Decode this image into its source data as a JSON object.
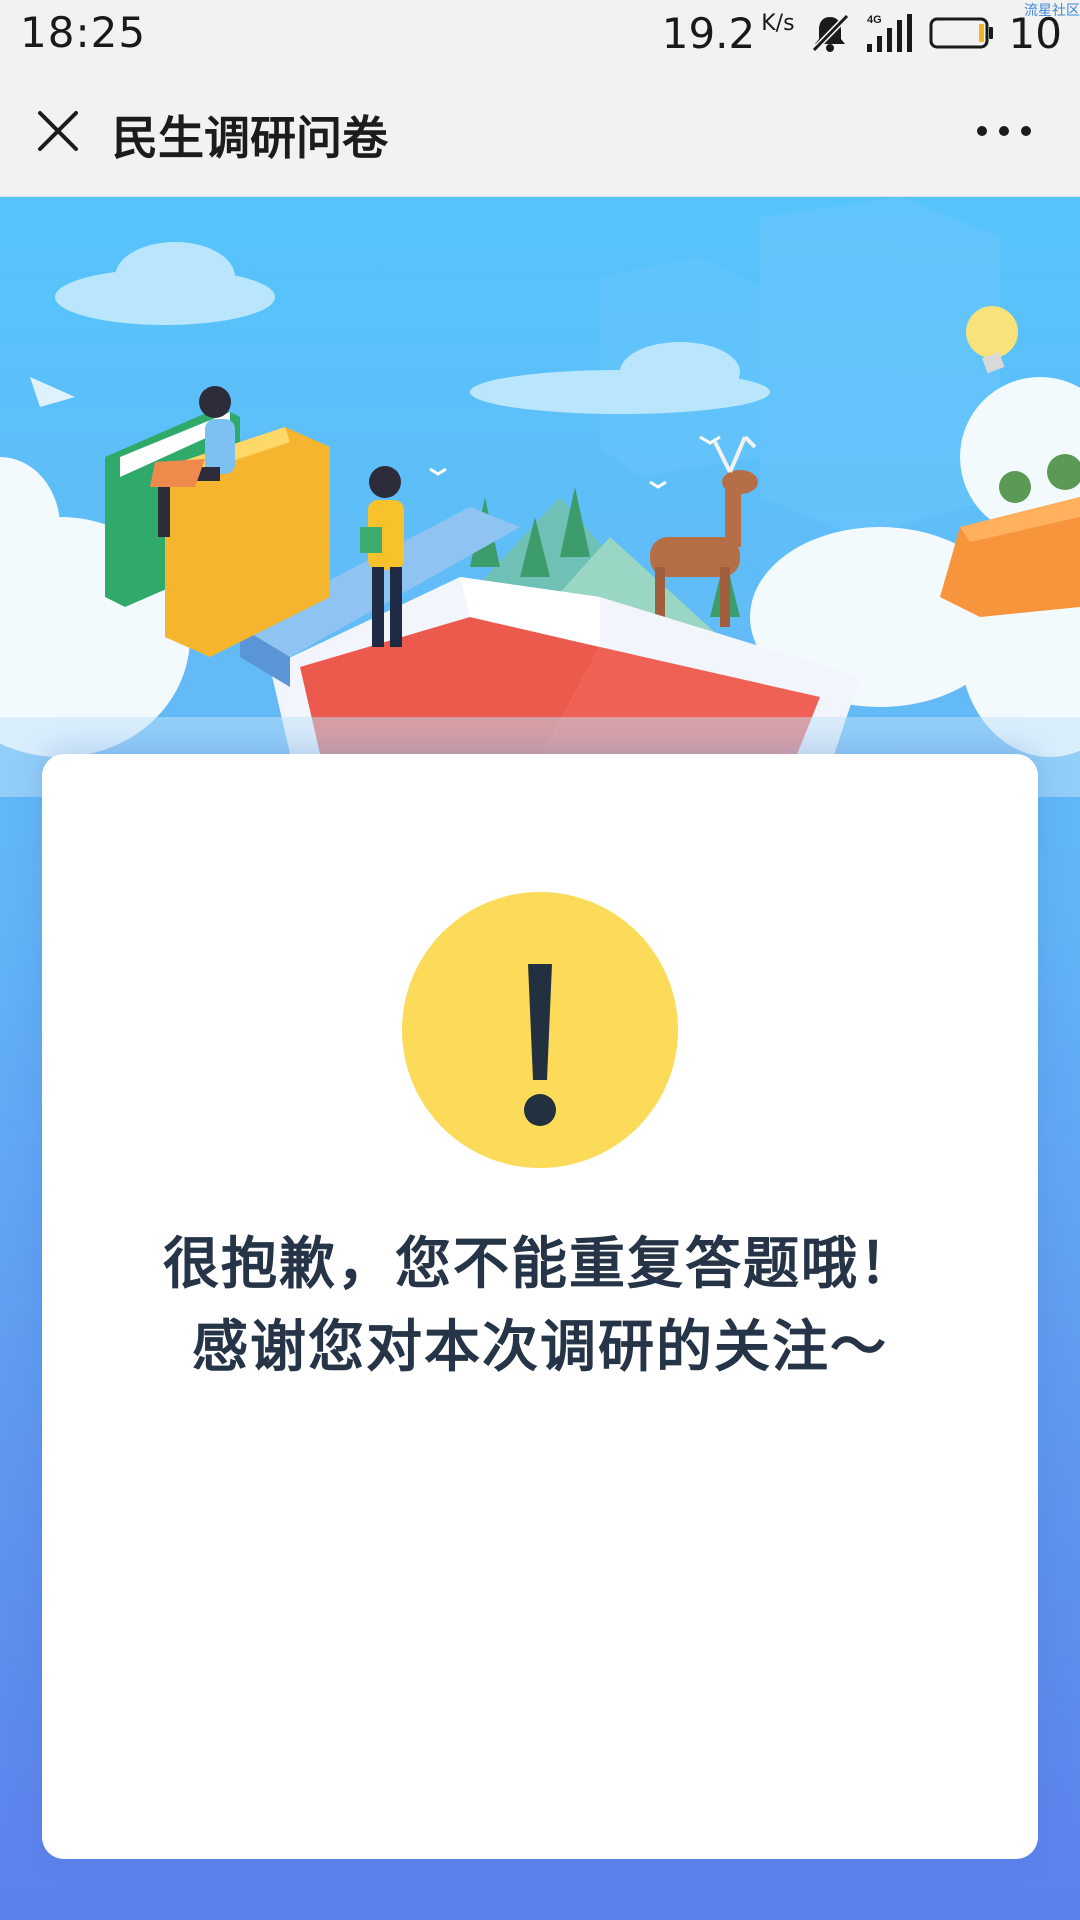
{
  "status_bar": {
    "time": "18:25",
    "net_speed": "19.2",
    "net_unit": "K/s",
    "network_label": "4G",
    "battery": "10",
    "watermark": "流星社区",
    "icons": [
      "mute-bell-icon",
      "signal-icon",
      "battery-icon"
    ]
  },
  "header": {
    "title": "民生调研问卷",
    "close_icon": "close-icon",
    "more_icon": "more-dots-icon"
  },
  "notice": {
    "line1": "很抱歉，您不能重复答题哦！",
    "line2": "感谢您对本次调研的关注～",
    "icon": "exclamation-icon",
    "icon_color": "#fddb5a",
    "text_color": "#253446"
  },
  "colors": {
    "background_top": "#59c2fa",
    "background_bottom": "#5c80ec",
    "card": "#ffffff"
  }
}
